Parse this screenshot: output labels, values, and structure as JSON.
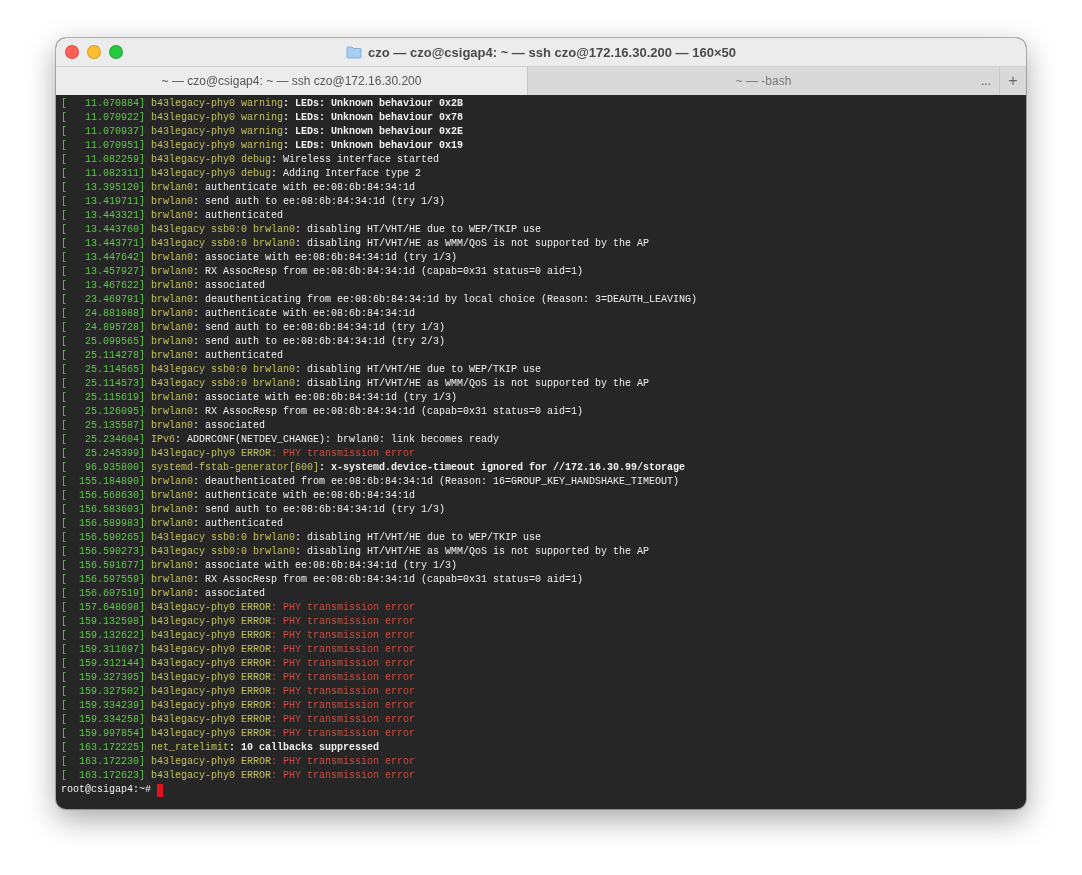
{
  "window": {
    "title": "czo — czo@csigap4: ~ — ssh czo@172.16.30.200 — 160×50"
  },
  "tabs": [
    {
      "label": "~ — czo@csigap4: ~ — ssh czo@172.16.30.200",
      "selected": true
    },
    {
      "label": "~ — -bash",
      "selected": false
    }
  ],
  "tab_overflow": "...",
  "new_tab": "+",
  "lines": [
    {
      "time": "[   11.070884]",
      "source": " b43legacy-phy0 warning",
      "message": ": LEDs: Unknown behaviour 0x2B",
      "kind": "bold"
    },
    {
      "time": "[   11.070922]",
      "source": " b43legacy-phy0 warning",
      "message": ": LEDs: Unknown behaviour 0x78",
      "kind": "bold"
    },
    {
      "time": "[   11.070937]",
      "source": " b43legacy-phy0 warning",
      "message": ": LEDs: Unknown behaviour 0x2E",
      "kind": "bold"
    },
    {
      "time": "[   11.070951]",
      "source": " b43legacy-phy0 warning",
      "message": ": LEDs: Unknown behaviour 0x19",
      "kind": "bold"
    },
    {
      "time": "[   11.082259]",
      "source": " b43legacy-phy0 debug",
      "message": ": Wireless interface started",
      "kind": "normal"
    },
    {
      "time": "[   11.082311]",
      "source": " b43legacy-phy0 debug",
      "message": ": Adding Interface type 2",
      "kind": "normal"
    },
    {
      "time": "[   13.395120]",
      "source": " brwlan0",
      "message": ": authenticate with ee:08:6b:84:34:1d",
      "kind": "normal"
    },
    {
      "time": "[   13.419711]",
      "source": " brwlan0",
      "message": ": send auth to ee:08:6b:84:34:1d (try 1/3)",
      "kind": "normal"
    },
    {
      "time": "[   13.443321]",
      "source": " brwlan0",
      "message": ": authenticated",
      "kind": "normal"
    },
    {
      "time": "[   13.443760]",
      "source": " b43legacy ssb0:0 brwlan0",
      "message": ": disabling HT/VHT/HE due to WEP/TKIP use",
      "kind": "normal"
    },
    {
      "time": "[   13.443771]",
      "source": " b43legacy ssb0:0 brwlan0",
      "message": ": disabling HT/VHT/HE as WMM/QoS is not supported by the AP",
      "kind": "normal"
    },
    {
      "time": "[   13.447642]",
      "source": " brwlan0",
      "message": ": associate with ee:08:6b:84:34:1d (try 1/3)",
      "kind": "normal"
    },
    {
      "time": "[   13.457927]",
      "source": " brwlan0",
      "message": ": RX AssocResp from ee:08:6b:84:34:1d (capab=0x31 status=0 aid=1)",
      "kind": "normal"
    },
    {
      "time": "[   13.467622]",
      "source": " brwlan0",
      "message": ": associated",
      "kind": "normal"
    },
    {
      "time": "[   23.469791]",
      "source": " brwlan0",
      "message": ": deauthenticating from ee:08:6b:84:34:1d by local choice (Reason: 3=DEAUTH_LEAVING)",
      "kind": "normal"
    },
    {
      "time": "[   24.881088]",
      "source": " brwlan0",
      "message": ": authenticate with ee:08:6b:84:34:1d",
      "kind": "normal"
    },
    {
      "time": "[   24.895728]",
      "source": " brwlan0",
      "message": ": send auth to ee:08:6b:84:34:1d (try 1/3)",
      "kind": "normal"
    },
    {
      "time": "[   25.099565]",
      "source": " brwlan0",
      "message": ": send auth to ee:08:6b:84:34:1d (try 2/3)",
      "kind": "normal"
    },
    {
      "time": "[   25.114278]",
      "source": " brwlan0",
      "message": ": authenticated",
      "kind": "normal"
    },
    {
      "time": "[   25.114565]",
      "source": " b43legacy ssb0:0 brwlan0",
      "message": ": disabling HT/VHT/HE due to WEP/TKIP use",
      "kind": "normal"
    },
    {
      "time": "[   25.114573]",
      "source": " b43legacy ssb0:0 brwlan0",
      "message": ": disabling HT/VHT/HE as WMM/QoS is not supported by the AP",
      "kind": "normal"
    },
    {
      "time": "[   25.115619]",
      "source": " brwlan0",
      "message": ": associate with ee:08:6b:84:34:1d (try 1/3)",
      "kind": "normal"
    },
    {
      "time": "[   25.126095]",
      "source": " brwlan0",
      "message": ": RX AssocResp from ee:08:6b:84:34:1d (capab=0x31 status=0 aid=1)",
      "kind": "normal"
    },
    {
      "time": "[   25.135587]",
      "source": " brwlan0",
      "message": ": associated",
      "kind": "normal"
    },
    {
      "time": "[   25.234604]",
      "source": " IPv6",
      "message": ": ADDRCONF(NETDEV_CHANGE): brwlan0: link becomes ready",
      "kind": "normal"
    },
    {
      "time": "[   25.245399]",
      "source": " b43legacy-phy0 ERROR",
      "message": ": PHY transmission error",
      "kind": "error"
    },
    {
      "time": "[   96.935800]",
      "source": " systemd-fstab-generator[600]",
      "message": ": x-systemd.device-timeout ignored for //172.16.30.99/storage",
      "kind": "bold"
    },
    {
      "time": "[  155.184890]",
      "source": " brwlan0",
      "message": ": deauthenticated from ee:08:6b:84:34:1d (Reason: 16=GROUP_KEY_HANDSHAKE_TIMEOUT)",
      "kind": "normal"
    },
    {
      "time": "[  156.568630]",
      "source": " brwlan0",
      "message": ": authenticate with ee:08:6b:84:34:1d",
      "kind": "normal"
    },
    {
      "time": "[  156.583603]",
      "source": " brwlan0",
      "message": ": send auth to ee:08:6b:84:34:1d (try 1/3)",
      "kind": "normal"
    },
    {
      "time": "[  156.589983]",
      "source": " brwlan0",
      "message": ": authenticated",
      "kind": "normal"
    },
    {
      "time": "[  156.590265]",
      "source": " b43legacy ssb0:0 brwlan0",
      "message": ": disabling HT/VHT/HE due to WEP/TKIP use",
      "kind": "normal"
    },
    {
      "time": "[  156.590273]",
      "source": " b43legacy ssb0:0 brwlan0",
      "message": ": disabling HT/VHT/HE as WMM/QoS is not supported by the AP",
      "kind": "normal"
    },
    {
      "time": "[  156.591677]",
      "source": " brwlan0",
      "message": ": associate with ee:08:6b:84:34:1d (try 1/3)",
      "kind": "normal"
    },
    {
      "time": "[  156.597559]",
      "source": " brwlan0",
      "message": ": RX AssocResp from ee:08:6b:84:34:1d (capab=0x31 status=0 aid=1)",
      "kind": "normal"
    },
    {
      "time": "[  156.607519]",
      "source": " brwlan0",
      "message": ": associated",
      "kind": "normal"
    },
    {
      "time": "[  157.648698]",
      "source": " b43legacy-phy0 ERROR",
      "message": ": PHY transmission error",
      "kind": "error"
    },
    {
      "time": "[  159.132598]",
      "source": " b43legacy-phy0 ERROR",
      "message": ": PHY transmission error",
      "kind": "error"
    },
    {
      "time": "[  159.132622]",
      "source": " b43legacy-phy0 ERROR",
      "message": ": PHY transmission error",
      "kind": "error"
    },
    {
      "time": "[  159.311697]",
      "source": " b43legacy-phy0 ERROR",
      "message": ": PHY transmission error",
      "kind": "error"
    },
    {
      "time": "[  159.312144]",
      "source": " b43legacy-phy0 ERROR",
      "message": ": PHY transmission error",
      "kind": "error"
    },
    {
      "time": "[  159.327395]",
      "source": " b43legacy-phy0 ERROR",
      "message": ": PHY transmission error",
      "kind": "error"
    },
    {
      "time": "[  159.327502]",
      "source": " b43legacy-phy0 ERROR",
      "message": ": PHY transmission error",
      "kind": "error"
    },
    {
      "time": "[  159.334239]",
      "source": " b43legacy-phy0 ERROR",
      "message": ": PHY transmission error",
      "kind": "error"
    },
    {
      "time": "[  159.334258]",
      "source": " b43legacy-phy0 ERROR",
      "message": ": PHY transmission error",
      "kind": "error"
    },
    {
      "time": "[  159.997854]",
      "source": " b43legacy-phy0 ERROR",
      "message": ": PHY transmission error",
      "kind": "error"
    },
    {
      "time": "[  163.172225]",
      "source": " net_ratelimit",
      "message": ": 10 callbacks suppressed",
      "kind": "bold"
    },
    {
      "time": "[  163.172230]",
      "source": " b43legacy-phy0 ERROR",
      "message": ": PHY transmission error",
      "kind": "error"
    },
    {
      "time": "[  163.172623]",
      "source": " b43legacy-phy0 ERROR",
      "message": ": PHY transmission error",
      "kind": "error"
    }
  ],
  "prompt": "root@csigap4:~# "
}
